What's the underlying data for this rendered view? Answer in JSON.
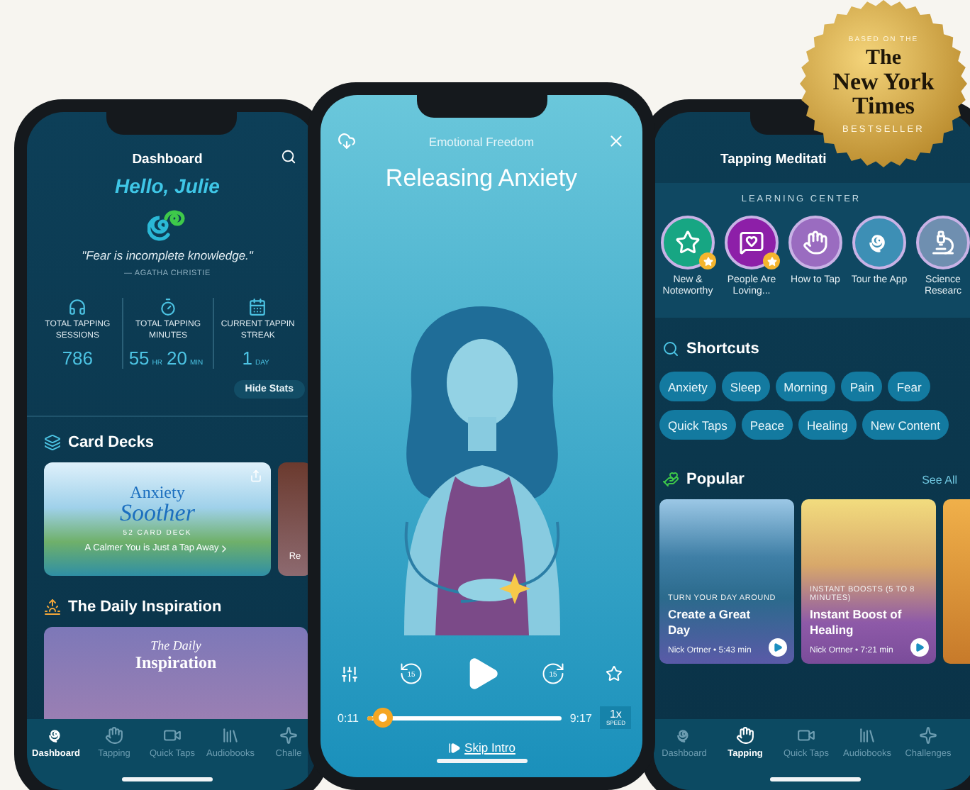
{
  "badge": {
    "top": "BASED ON THE",
    "title_lines": [
      "The",
      "New York",
      "Times"
    ],
    "bottom": "BESTSELLER"
  },
  "dashboard_screen": {
    "title": "Dashboard",
    "greeting": "Hello, Julie",
    "quote": "\"Fear is incomplete knowledge.\"",
    "quote_author": "— AGATHA CHRISTIE",
    "stats": [
      {
        "label_lines": [
          "TOTAL TAPPING",
          "SESSIONS"
        ],
        "value": [
          {
            "number": "786"
          }
        ]
      },
      {
        "label_lines": [
          "TOTAL TAPPING",
          "MINUTES"
        ],
        "value": [
          {
            "number": "55",
            "unit": "HR"
          },
          {
            "number": "20",
            "unit": "MIN"
          }
        ]
      },
      {
        "label_lines": [
          "CURRENT TAPPIN",
          "STREAK"
        ],
        "value": [
          {
            "number": "1",
            "unit": "DAY"
          }
        ]
      }
    ],
    "hide_stats_button": "Hide Stats",
    "card_decks": {
      "heading": "Card Decks",
      "cards": [
        {
          "title_lines": [
            "Anxiety",
            "Soother"
          ],
          "subtitle": "52 CARD DECK",
          "tagline": "A Calmer You is Just a Tap Away"
        },
        {
          "tagline": "Re"
        }
      ]
    },
    "daily_inspiration": {
      "heading": "The Daily Inspiration",
      "card_lines": [
        "The Daily",
        "Inspiration"
      ]
    },
    "tabs": [
      {
        "label": "Dashboard",
        "selected": true
      },
      {
        "label": "Tapping",
        "selected": false
      },
      {
        "label": "Quick Taps",
        "selected": false
      },
      {
        "label": "Audiobooks",
        "selected": false
      },
      {
        "label": "Challe",
        "selected": false
      }
    ]
  },
  "player_screen": {
    "category": "Emotional Freedom",
    "title": "Releasing Anxiety",
    "rewind_label": "15",
    "forward_label": "15",
    "elapsed": "0:11",
    "duration": "9:17",
    "level": 0.03,
    "speed": "1x",
    "speed_label": "SPEED",
    "skip_label": "Skip Intro"
  },
  "tapping_screen": {
    "title": "Tapping Meditati",
    "learning_center": {
      "heading": "LEARNING CENTER",
      "items": [
        {
          "label": "New & Noteworthy",
          "color": "#17a683",
          "starred": true
        },
        {
          "label": "People Are Loving...",
          "color": "#8d1fa8",
          "starred": true
        },
        {
          "label": "How to Tap",
          "color": "#9a6cc0",
          "starred": false
        },
        {
          "label": "Tour the App",
          "color": "#3d8fb5",
          "starred": false
        },
        {
          "label": "Science Researc",
          "color": "#6f8fb0",
          "starred": false
        }
      ]
    },
    "shortcuts": {
      "heading": "Shortcuts",
      "chip_rows": [
        [
          "Anxiety",
          "Sleep",
          "Morning",
          "Pain",
          "Fear"
        ],
        [
          "Quick Taps",
          "Peace",
          "Healing",
          "New Content"
        ]
      ]
    },
    "popular": {
      "heading": "Popular",
      "see_all": "See All",
      "cards": [
        {
          "eyebrow": "TURN YOUR DAY AROUND",
          "title": "Create a Great Day",
          "meta": "Nick Ortner • 5:43 min"
        },
        {
          "eyebrow": "INSTANT BOOSTS (5 TO 8 MINUTES)",
          "title": "Instant Boost of Healing",
          "meta": "Nick Ortner • 7:21 min"
        }
      ]
    },
    "tabs": [
      {
        "label": "Dashboard",
        "selected": false
      },
      {
        "label": "Tapping",
        "selected": true
      },
      {
        "label": "Quick Taps",
        "selected": false
      },
      {
        "label": "Audiobooks",
        "selected": false
      },
      {
        "label": "Challenges",
        "selected": false
      }
    ]
  }
}
